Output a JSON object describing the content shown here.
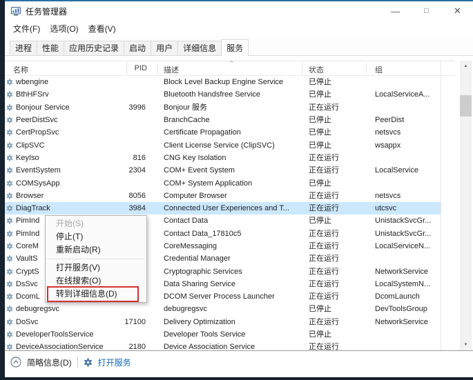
{
  "window": {
    "title": "任务管理器"
  },
  "icons": {
    "minimize": "—",
    "maximize": "□",
    "close": "✕",
    "scroll_up": "▲",
    "scroll_down": "▼",
    "sort_ascending": "^",
    "app_icon": "task-manager-monitor",
    "service_icon": "gear",
    "footer_toggle_icon": "chevron-up-in-circle"
  },
  "menu_bar": {
    "items": [
      "文件(F)",
      "选项(O)",
      "查看(V)"
    ]
  },
  "tabs": [
    {
      "id": "processes",
      "label": "进程",
      "active": false
    },
    {
      "id": "performance",
      "label": "性能",
      "active": false
    },
    {
      "id": "app-history",
      "label": "应用历史记录",
      "active": false
    },
    {
      "id": "startup",
      "label": "启动",
      "active": false
    },
    {
      "id": "users",
      "label": "用户",
      "active": false
    },
    {
      "id": "details",
      "label": "详细信息",
      "active": false
    },
    {
      "id": "services",
      "label": "服务",
      "active": true
    }
  ],
  "table": {
    "columns": {
      "name": "名称",
      "pid": "PID",
      "description": "描述",
      "status": "状态",
      "group": "组"
    },
    "sorted_column": "description",
    "rows": [
      {
        "name": "wbengine",
        "pid": "",
        "description": "Block Level Backup Engine Service",
        "status": "已停止",
        "group": "",
        "selected": false
      },
      {
        "name": "BthHFSrv",
        "pid": "",
        "description": "Bluetooth Handsfree Service",
        "status": "已停止",
        "group": "LocalServiceA...",
        "selected": false
      },
      {
        "name": "Bonjour Service",
        "pid": "3996",
        "description": "Bonjour 服务",
        "status": "正在运行",
        "group": "",
        "selected": false
      },
      {
        "name": "PeerDistSvc",
        "pid": "",
        "description": "BranchCache",
        "status": "已停止",
        "group": "PeerDist",
        "selected": false
      },
      {
        "name": "CertPropSvc",
        "pid": "",
        "description": "Certificate Propagation",
        "status": "已停止",
        "group": "netsvcs",
        "selected": false
      },
      {
        "name": "ClipSVC",
        "pid": "",
        "description": "Client License Service (ClipSVC)",
        "status": "已停止",
        "group": "wsappx",
        "selected": false
      },
      {
        "name": "KeyIso",
        "pid": "816",
        "description": "CNG Key Isolation",
        "status": "正在运行",
        "group": "",
        "selected": false
      },
      {
        "name": "EventSystem",
        "pid": "2304",
        "description": "COM+ Event System",
        "status": "正在运行",
        "group": "LocalService",
        "selected": false
      },
      {
        "name": "COMSysApp",
        "pid": "",
        "description": "COM+ System Application",
        "status": "已停止",
        "group": "",
        "selected": false
      },
      {
        "name": "Browser",
        "pid": "8056",
        "description": "Computer Browser",
        "status": "正在运行",
        "group": "netsvcs",
        "selected": false
      },
      {
        "name": "DiagTrack",
        "pid": "3984",
        "description": "Connected User Experiences and T...",
        "status": "正在运行",
        "group": "utcsvc",
        "selected": true
      },
      {
        "name": "PimInd",
        "pid": "",
        "description": "Contact Data",
        "status": "已停止",
        "group": "UnistackSvcGr...",
        "selected": false
      },
      {
        "name": "PimInd",
        "pid": "",
        "description": "Contact Data_17810c5",
        "status": "正在运行",
        "group": "UnistackSvcGr...",
        "selected": false
      },
      {
        "name": "CoreM",
        "pid": "",
        "description": "CoreMessaging",
        "status": "正在运行",
        "group": "LocalServiceN...",
        "selected": false
      },
      {
        "name": "VaultS",
        "pid": "",
        "description": "Credential Manager",
        "status": "正在运行",
        "group": "",
        "selected": false
      },
      {
        "name": "CryptS",
        "pid": "",
        "description": "Cryptographic Services",
        "status": "正在运行",
        "group": "NetworkService",
        "selected": false
      },
      {
        "name": "DsSvc",
        "pid": "",
        "description": "Data Sharing Service",
        "status": "正在运行",
        "group": "LocalSystemN...",
        "selected": false
      },
      {
        "name": "DcomL",
        "pid": "",
        "description": "DCOM Server Process Launcher",
        "status": "正在运行",
        "group": "DcomLaunch",
        "selected": false
      },
      {
        "name": "debugregsvc",
        "pid": "",
        "description": "debugregsvc",
        "status": "已停止",
        "group": "DevToolsGroup",
        "selected": false
      },
      {
        "name": "DoSvc",
        "pid": "17100",
        "description": "Delivery Optimization",
        "status": "正在运行",
        "group": "NetworkService",
        "selected": false
      },
      {
        "name": "DeveloperToolsService",
        "pid": "",
        "description": "Developer Tools Service",
        "status": "已停止",
        "group": "",
        "selected": false
      },
      {
        "name": "DeviceAssociationService",
        "pid": "2180",
        "description": "Device Association Service",
        "status": "正在运行",
        "group": "",
        "selected": false
      }
    ]
  },
  "context_menu": {
    "items": [
      {
        "label": "开始(S)",
        "disabled": true,
        "annotated": false
      },
      {
        "label": "停止(T)",
        "disabled": false,
        "annotated": false
      },
      {
        "label": "重新启动(R)",
        "disabled": false,
        "annotated": false
      },
      {
        "type": "separator"
      },
      {
        "label": "打开服务(V)",
        "disabled": false,
        "annotated": false
      },
      {
        "label": "在线搜索(O)",
        "disabled": false,
        "annotated": false
      },
      {
        "label": "转到详细信息(D)",
        "disabled": false,
        "annotated": true
      }
    ]
  },
  "footer": {
    "toggle_label": "简略信息(D)",
    "open_services_label": "打开服务"
  },
  "colors": {
    "selection": "#cce8ff",
    "accent_blue": "#2d6da5",
    "link_blue": "#1668b5",
    "annotation_red": "#d43030"
  }
}
